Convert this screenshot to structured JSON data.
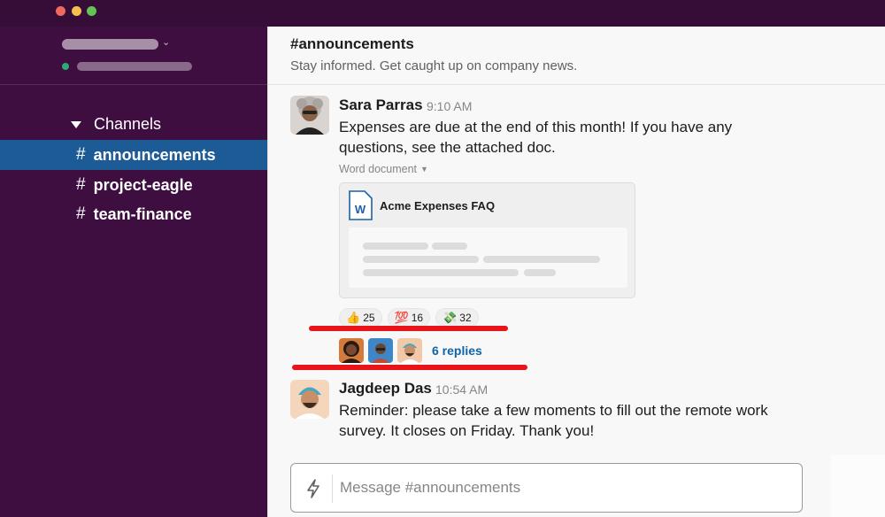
{
  "sidebar": {
    "section_label": "Channels",
    "channels": [
      {
        "name": "announcements",
        "active": true
      },
      {
        "name": "project-eagle",
        "active": false
      },
      {
        "name": "team-finance",
        "active": false
      }
    ]
  },
  "channel": {
    "title": "#announcements",
    "topic": "Stay informed. Get caught up on company news."
  },
  "messages": [
    {
      "author": "Sara Parras",
      "time": "9:10 AM",
      "text": "Expenses are due at the end of this month! If you have any questions, see the attached doc.",
      "attachment": {
        "type_label": "Word document",
        "title": "Acme Expenses FAQ",
        "icon": "word-doc-icon"
      },
      "reactions": [
        {
          "emoji": "👍",
          "icon": "thumbs-up-emoji",
          "count": "25"
        },
        {
          "emoji": "💯",
          "icon": "hundred-points-emoji",
          "count": "16"
        },
        {
          "emoji": "💸",
          "icon": "money-with-wings-emoji",
          "count": "32"
        }
      ],
      "replies_label": "6 replies"
    },
    {
      "author": "Jagdeep Das",
      "time": "10:54 AM",
      "text": "Reminder: please take a few moments to fill out the remote work survey. It closes on Friday. Thank you!"
    }
  ],
  "composer": {
    "placeholder": "Message #announcements"
  },
  "colors": {
    "sidebar_bg": "#3f0e40",
    "active_channel": "#1d5b97",
    "link": "#1264a3",
    "annotation_red": "#e8141a"
  }
}
